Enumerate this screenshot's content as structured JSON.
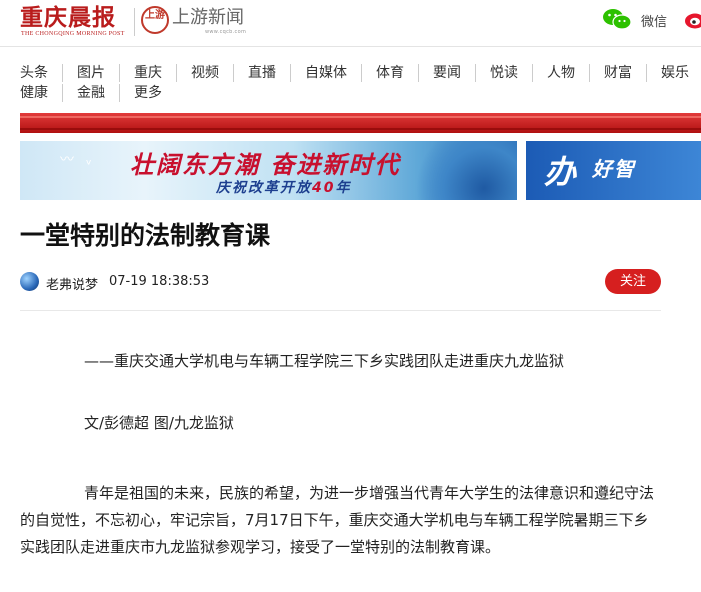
{
  "header": {
    "logo_title": "重庆晨报",
    "logo_subtitle": "THE CHONGQING MORNING POST",
    "partner_badge": "上游",
    "partner_name": "上游新闻",
    "partner_url": "www.cqcb.com",
    "wechat_label": "微信"
  },
  "nav": {
    "row1": [
      "头条",
      "图片",
      "重庆",
      "视频",
      "直播",
      "自媒体",
      "体育",
      "要闻",
      "悦读",
      "人物",
      "财富",
      "娱乐"
    ],
    "row2": [
      "健康",
      "金融",
      "更多"
    ]
  },
  "banners": {
    "main_slogan": "壮阔东方潮 奋进新时代",
    "main_sub_prefix": "庆祝改革开放",
    "main_sub_num": "40",
    "main_sub_suffix": "年",
    "side_mark": "办",
    "side_text": "好智"
  },
  "article": {
    "title": "一堂特别的法制教育课",
    "author": "老弗说梦",
    "time": "07-19 18:38:53",
    "follow_label": "关注",
    "paragraphs": [
      "——重庆交通大学机电与车辆工程学院三下乡实践团队走进重庆九龙监狱",
      "文/彭德超 图/九龙监狱",
      "青年是祖国的未来，民族的希望，为进一步增强当代青年大学生的法律意识和遵纪守法的自觉性，不忘初心，牢记宗旨，7月17日下午，重庆交通大学机电与车辆工程学院暑期三下乡实践团队走进重庆市九龙监狱参观学习，接受了一堂特别的法制教育课。"
    ]
  },
  "colors": {
    "brand_red": "#b91c1c",
    "follow_red": "#d61f1f",
    "wechat_green": "#2dc100"
  }
}
